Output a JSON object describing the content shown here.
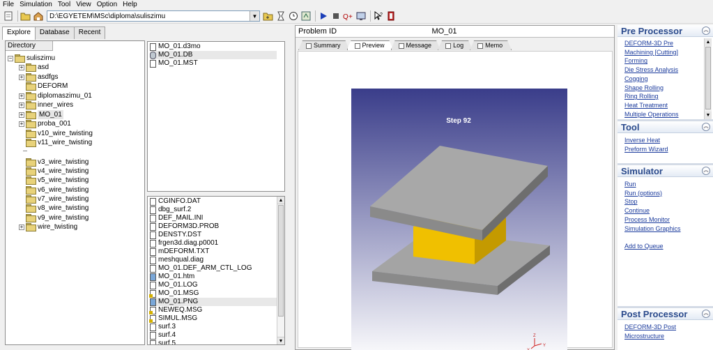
{
  "menu": [
    "File",
    "Simulation",
    "Tool",
    "View",
    "Option",
    "Help"
  ],
  "toolbar": {
    "path": "D:\\EGYETEM\\MSc\\diploma\\suliszimu"
  },
  "left_tabs": [
    "Explore",
    "Database",
    "Recent"
  ],
  "directory": {
    "header": "Directory",
    "root": "suliszimu",
    "items": [
      {
        "label": "asd",
        "expandable": true
      },
      {
        "label": "asdfgs",
        "expandable": true
      },
      {
        "label": "DEFORM",
        "expandable": false
      },
      {
        "label": "diplomaszimu_01",
        "expandable": true
      },
      {
        "label": "inner_wires",
        "expandable": true
      },
      {
        "label": "MO_01",
        "expandable": true,
        "selected": true
      },
      {
        "label": "proba_001",
        "expandable": true
      },
      {
        "label": "v10_wire_twisting",
        "expandable": false
      },
      {
        "label": "v11_wire_twisting",
        "expandable": false
      },
      {
        "label": "v3_wire_twisting",
        "expandable": false
      },
      {
        "label": "v4_wire_twisting",
        "expandable": false
      },
      {
        "label": "v5_wire_twisting",
        "expandable": false
      },
      {
        "label": "v6_wire_twisting",
        "expandable": false
      },
      {
        "label": "v7_wire_twisting",
        "expandable": false
      },
      {
        "label": "v8_wire_twisting",
        "expandable": false
      },
      {
        "label": "v9_wire_twisting",
        "expandable": false
      },
      {
        "label": "wire_twisting",
        "expandable": true
      }
    ]
  },
  "files_top": [
    {
      "name": "MO_01.d3mo",
      "icon": "doc"
    },
    {
      "name": "MO_01.DB",
      "icon": "db",
      "selected": true
    },
    {
      "name": "MO_01.MST",
      "icon": "doc"
    }
  ],
  "files_bottom": [
    {
      "name": "CGINFO.DAT",
      "icon": "doc"
    },
    {
      "name": "dbg_surf.2",
      "icon": "doc"
    },
    {
      "name": "DEF_MAIL.INI",
      "icon": "doc"
    },
    {
      "name": "DEFORM3D.PROB",
      "icon": "doc"
    },
    {
      "name": "DENSTY.DST",
      "icon": "doc"
    },
    {
      "name": "frgen3d.diag.p0001",
      "icon": "doc"
    },
    {
      "name": "mDEFORM.TXT",
      "icon": "doc"
    },
    {
      "name": "meshqual.diag",
      "icon": "doc"
    },
    {
      "name": "MO_01.DEF_ARM_CTL_LOG",
      "icon": "doc"
    },
    {
      "name": "MO_01.htm",
      "icon": "img"
    },
    {
      "name": "MO_01.LOG",
      "icon": "doc"
    },
    {
      "name": "MO_01.MSG",
      "icon": "msg"
    },
    {
      "name": "MO_01.PNG",
      "icon": "img",
      "selected": true
    },
    {
      "name": "NEWEQ.MSG",
      "icon": "msg"
    },
    {
      "name": "SIMUL.MSG",
      "icon": "msg"
    },
    {
      "name": "surf.3",
      "icon": "doc"
    },
    {
      "name": "surf.4",
      "icon": "doc"
    },
    {
      "name": "surf.5",
      "icon": "doc"
    }
  ],
  "center": {
    "problem_label": "Problem ID",
    "problem_value": "MO_01",
    "tabs": [
      "Summary",
      "Preview",
      "Message",
      "Log",
      "Memo"
    ],
    "active_tab": "Preview",
    "step_text": "Step  92",
    "axes": {
      "x": "X",
      "y": "Y",
      "z": "Z"
    }
  },
  "colors": {
    "viewport_top": "#3a3d8a",
    "viewport_bottom": "#ffffff",
    "die": "#8a8a8a",
    "workpiece": "#f0c000",
    "accent_header": "#2a4a8c"
  },
  "right": {
    "pre": {
      "title": "Pre Processor",
      "items": [
        "DEFORM-3D Pre",
        "Machining [Cutting]",
        "Forming",
        "Die Stress Analysis",
        "Cogging",
        "Shape Rolling",
        "Ring Rolling",
        "Heat Treatment",
        "Multiple Operations"
      ]
    },
    "tool": {
      "title": "Tool",
      "items": [
        "Inverse Heat",
        "Preform Wizard"
      ]
    },
    "simulator": {
      "title": "Simulator",
      "items": [
        "Run",
        "Run (options)",
        "Stop",
        "Continue",
        "Process Monitor",
        "Simulation Graphics"
      ],
      "extra": "Add to Queue"
    },
    "post": {
      "title": "Post Processor",
      "items": [
        "DEFORM-3D Post",
        "Microstructure"
      ]
    }
  }
}
